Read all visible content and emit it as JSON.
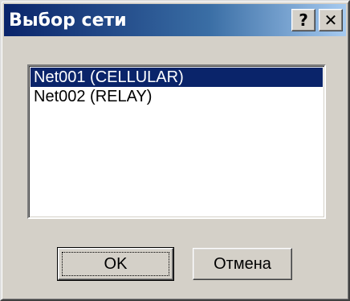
{
  "dialog": {
    "title": "Выбор сети",
    "help_button": "?",
    "close_button": "✕"
  },
  "network_list": {
    "items": [
      {
        "label": "Net001 (CELLULAR)",
        "selected": true
      },
      {
        "label": "Net002 (RELAY)",
        "selected": false
      }
    ]
  },
  "buttons": {
    "ok_label": "OK",
    "cancel_label": "Отмена"
  },
  "colors": {
    "titlebar_start": "#0a246a",
    "titlebar_end": "#a6caf0",
    "face": "#d4d0c8",
    "selection": "#0a246a"
  }
}
